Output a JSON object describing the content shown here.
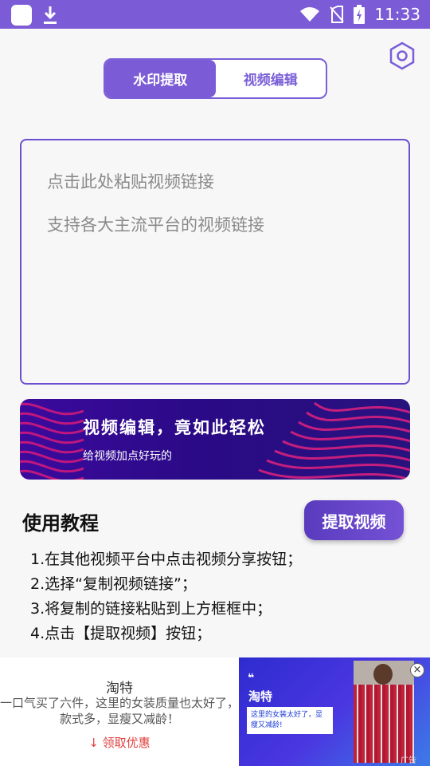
{
  "status_bar": {
    "time": "11:33"
  },
  "tabs": [
    {
      "label": "水印提取",
      "active": true
    },
    {
      "label": "视频编辑",
      "active": false
    }
  ],
  "link_input": {
    "placeholder_line1": "点击此处粘贴视频链接",
    "placeholder_line2": "支持各大主流平台的视频链接"
  },
  "banner": {
    "title": "视频编辑，竟如此轻松",
    "subtitle": "给视频加点好玩的"
  },
  "tutorial": {
    "title": "使用教程",
    "extract_button": "提取视频",
    "steps": [
      "1.在其他视频平台中点击视频分享按钮；",
      "2.选择“复制视频链接”；",
      "3.将复制的链接粘贴到上方框框中；",
      "4.点击【提取视频】按钮；"
    ]
  },
  "ad": {
    "brand": "淘特",
    "description": "一口气买了六件，这里的女装质量也太好了，款式多，显瘦又减龄！",
    "cta": "领取优惠",
    "image_brand": "淘特",
    "image_quote": "这里的女装太好了，显瘦又减龄!",
    "label": "广告"
  },
  "colors": {
    "accent": "#7c5bd6",
    "banner_bg": "#2a0a86",
    "ad_cta": "#e04040"
  },
  "icons": [
    "app-icon",
    "download-icon",
    "wifi-icon",
    "no-sim-icon",
    "battery-icon",
    "settings-hexagon-icon",
    "download-arrow-icon",
    "close-icon"
  ]
}
